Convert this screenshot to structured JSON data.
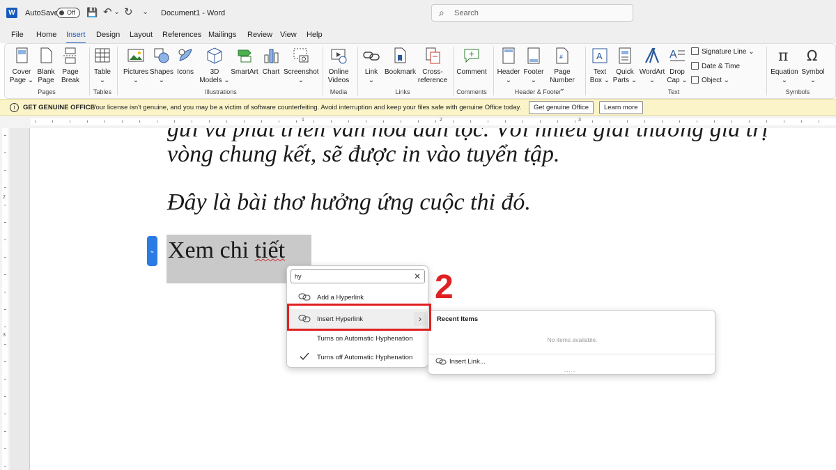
{
  "titlebar": {
    "app_letter": "W",
    "autosave_label": "AutoSave",
    "autosave_state": "Off",
    "save_glyph": "💾",
    "undo_glyph": "↶",
    "undo_dropdown": "⌄",
    "redo_glyph": "↻",
    "customize_glyph": "⌄",
    "doc_title": "Document1  -  Word",
    "search_placeholder": "Search"
  },
  "menubar": {
    "tabs": [
      "File",
      "Home",
      "Insert",
      "Design",
      "Layout",
      "References",
      "Mailings",
      "Review",
      "View",
      "Help"
    ],
    "active_tab": "Insert"
  },
  "ribbon": {
    "buttons": {
      "cover_page": [
        "Cover",
        "Page ⌄"
      ],
      "blank_page": [
        "Blank",
        "Page"
      ],
      "page_break": [
        "Page",
        "Break"
      ],
      "table": [
        "Table",
        "⌄"
      ],
      "pictures": [
        "Pictures",
        "⌄"
      ],
      "shapes": [
        "Shapes",
        "⌄"
      ],
      "icons": [
        "Icons",
        ""
      ],
      "models_3d": [
        "3D",
        "Models ⌄"
      ],
      "smartart": [
        "SmartArt",
        ""
      ],
      "chart": [
        "Chart",
        ""
      ],
      "screenshot": [
        "Screenshot",
        "⌄"
      ],
      "online_videos": [
        "Online",
        "Videos"
      ],
      "link": [
        "Link",
        "⌄"
      ],
      "bookmark": [
        "Bookmark",
        ""
      ],
      "cross_reference": [
        "Cross-",
        "reference"
      ],
      "comment": [
        "Comment",
        ""
      ],
      "header": [
        "Header",
        "⌄"
      ],
      "footer": [
        "Footer",
        "⌄"
      ],
      "page_number": [
        "Page",
        "Number ⌄"
      ],
      "text_box": [
        "Text",
        "Box ⌄"
      ],
      "quick_parts": [
        "Quick",
        "Parts ⌄"
      ],
      "wordart": [
        "WordArt",
        "⌄"
      ],
      "drop_cap": [
        "Drop",
        "Cap ⌄"
      ],
      "equation": [
        "Equation",
        "⌄"
      ],
      "symbol": [
        "Symbol",
        "⌄"
      ]
    },
    "small_buttons": {
      "signature_line": "Signature Line  ⌄",
      "date_time": "Date & Time",
      "object": "Object  ⌄"
    },
    "groups": {
      "pages": "Pages",
      "tables": "Tables",
      "illustrations": "Illustrations",
      "media": "Media",
      "links": "Links",
      "comments": "Comments",
      "header_footer": "Header & Footer",
      "text": "Text",
      "symbols": "Symbols"
    }
  },
  "license_bar": {
    "icon": "i",
    "title": "GET GENUINE OFFICE",
    "message": "Your license isn't genuine, and you may be a victim of software counterfeiting. Avoid interruption and keep your files safe with genuine Office today.",
    "primary_button": "Get genuine Office",
    "secondary_button": "Learn more"
  },
  "ruler": {
    "numbers": [
      "1",
      "2",
      "3"
    ],
    "vertical_numbers": [
      "2",
      "3"
    ]
  },
  "document": {
    "line_cut": "gửi và phát triển văn hóa dân tộc. Với nhiều giải thưởng giá trị",
    "line1": "vòng chung kết, sẽ được in vào tuyển tập.",
    "line2": "Đây là bài thơ hưởng ứng cuộc thi đó.",
    "selected_prefix": "Xem chi ",
    "selected_word": "tiết",
    "collapse_glyph": "⌄"
  },
  "context_menu": {
    "search_value": "hy",
    "clear_glyph": "✕",
    "items": [
      {
        "label": "Add a Hyperlink",
        "icon": "link-icon"
      },
      {
        "label": "Insert Hyperlink",
        "icon": "link-icon",
        "submenu_arrow": "›"
      },
      {
        "label": "Turns on Automatic Hyphenation",
        "icon": ""
      },
      {
        "label": "Turns off Automatic Hyphenation",
        "icon": "checkmark-icon"
      }
    ]
  },
  "annotation": {
    "step_number": "2",
    "color": "#e02020"
  },
  "submenu": {
    "title": "Recent Items",
    "empty_text": "No items available.",
    "insert_link": "Insert Link...",
    "grip": "....."
  },
  "colors": {
    "accent": "#185abd",
    "selection": "#c9c9c9",
    "license_bg": "#fbf4c9"
  }
}
